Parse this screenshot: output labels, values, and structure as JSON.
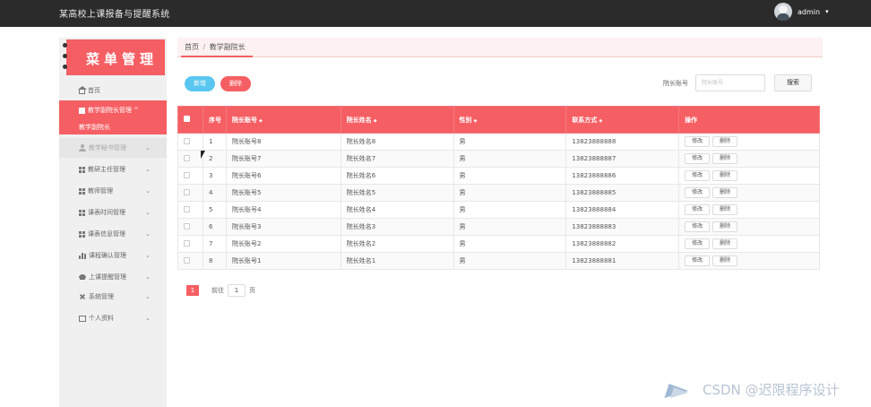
{
  "topbar": {
    "app_title": "某高校上课报备与提醒系统",
    "username": "admin",
    "caret": "▾"
  },
  "sidebar": {
    "menu_title": "菜单管理",
    "items": [
      {
        "label": "首页",
        "icon": "home-icon"
      },
      {
        "label": "教学副院长管理",
        "icon": "square-icon",
        "chevron": "^",
        "active": true
      },
      {
        "label": "教学副院长",
        "sub": true
      },
      {
        "label": "教学秘书管理",
        "icon": "user-icon",
        "chevron": "⌄"
      },
      {
        "label": "教研主任管理",
        "icon": "grid-icon",
        "chevron": "⌄"
      },
      {
        "label": "教师管理",
        "icon": "grid-icon",
        "chevron": "⌄"
      },
      {
        "label": "课表时间管理",
        "icon": "grid-icon",
        "chevron": "⌄"
      },
      {
        "label": "课表信息管理",
        "icon": "grid-icon",
        "chevron": "⌄"
      },
      {
        "label": "课程确认管理",
        "icon": "bar-chart-icon",
        "chevron": "⌄"
      },
      {
        "label": "上课提醒管理",
        "icon": "cap-icon",
        "chevron": "⌄"
      },
      {
        "label": "系统管理",
        "icon": "cross-icon",
        "chevron": "⌄"
      },
      {
        "label": "个人资料",
        "icon": "box-icon",
        "chevron": "⌄"
      }
    ]
  },
  "breadcrumb": {
    "home": "首页",
    "sep": "/",
    "current": "教学副院长"
  },
  "toolbar": {
    "add_label": "新增",
    "delete_label": "删除",
    "search_label": "院长账号",
    "search_placeholder": "院长账号",
    "search_button": "搜索"
  },
  "table": {
    "columns": [
      "序号",
      "院长账号",
      "院长姓名",
      "性别",
      "联系方式",
      "操作"
    ],
    "sort_glyph": "◆",
    "edit_label": "修改",
    "delete_label": "删除",
    "rows": [
      {
        "no": "1",
        "account": "院长账号8",
        "name": "院长姓名8",
        "gender": "男",
        "phone": "13823888888"
      },
      {
        "no": "2",
        "account": "院长账号7",
        "name": "院长姓名7",
        "gender": "男",
        "phone": "13823888887"
      },
      {
        "no": "3",
        "account": "院长账号6",
        "name": "院长姓名6",
        "gender": "男",
        "phone": "13823888886"
      },
      {
        "no": "4",
        "account": "院长账号5",
        "name": "院长姓名5",
        "gender": "男",
        "phone": "13823888885"
      },
      {
        "no": "5",
        "account": "院长账号4",
        "name": "院长姓名4",
        "gender": "男",
        "phone": "13823888884"
      },
      {
        "no": "6",
        "account": "院长账号3",
        "name": "院长姓名3",
        "gender": "男",
        "phone": "13823888883"
      },
      {
        "no": "7",
        "account": "院长账号2",
        "name": "院长姓名2",
        "gender": "男",
        "phone": "13823888882"
      },
      {
        "no": "8",
        "account": "院长账号1",
        "name": "院长姓名1",
        "gender": "男",
        "phone": "13823888881"
      }
    ]
  },
  "pagination": {
    "current_page": "1",
    "goto_label": "前往",
    "goto_value": "1",
    "page_unit": "页"
  },
  "watermark": {
    "text": "CSDN @迟限程序设计"
  },
  "colors": {
    "accent": "#f55f63",
    "info": "#59c7f0",
    "topbar": "#2b2b2b"
  }
}
